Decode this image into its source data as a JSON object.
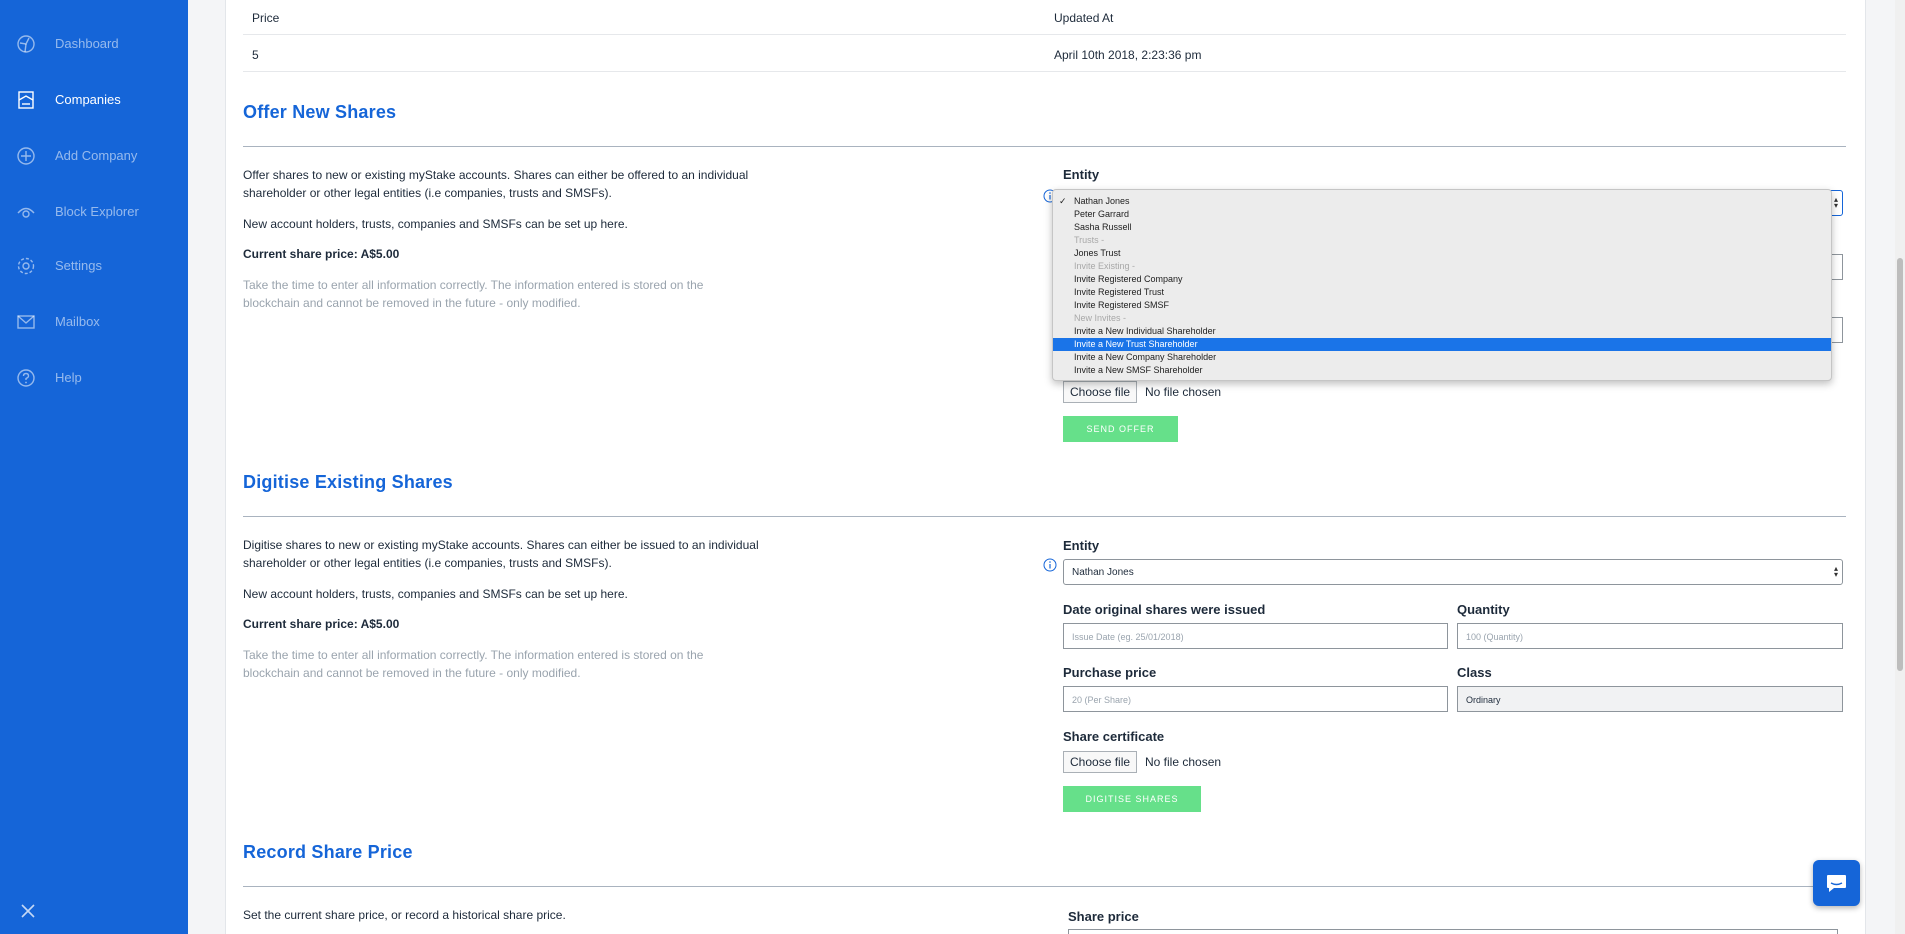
{
  "sidebar": {
    "items": [
      {
        "label": "Dashboard",
        "icon": "dashboard-icon"
      },
      {
        "label": "Companies",
        "icon": "companies-icon"
      },
      {
        "label": "Add Company",
        "icon": "add-circle-icon"
      },
      {
        "label": "Block Explorer",
        "icon": "eye-icon"
      },
      {
        "label": "Settings",
        "icon": "gear-icon"
      },
      {
        "label": "Mailbox",
        "icon": "mail-icon"
      },
      {
        "label": "Help",
        "icon": "help-icon"
      }
    ],
    "active": "Companies"
  },
  "price_table": {
    "headers": [
      "Price",
      "Updated At"
    ],
    "rows": [
      [
        "5",
        "April 10th 2018, 2:23:36 pm"
      ]
    ]
  },
  "offer": {
    "title": "Offer New Shares",
    "desc1": "Offer shares to new or existing myStake accounts. Shares can either be offered to an individual shareholder or other legal entities (i.e companies, trusts and SMSFs).",
    "desc2": "New account holders, trusts, companies and SMSFs can be set up here.",
    "price": "Current share price: A$5.00",
    "note": "Take the time to enter all information correctly. The information entered is stored on the blockchain and cannot be removed in the future - only modified.",
    "entity_label": "Entity",
    "file_button": "Choose file",
    "file_status": "No file chosen",
    "submit": "SEND OFFER",
    "dropdown": [
      {
        "label": "Nathan Jones",
        "type": "option",
        "checked": true
      },
      {
        "label": "Peter Garrard",
        "type": "option"
      },
      {
        "label": "Sasha Russell",
        "type": "option"
      },
      {
        "label": "Trusts -",
        "type": "group"
      },
      {
        "label": "Jones Trust",
        "type": "option"
      },
      {
        "label": "Invite Existing -",
        "type": "group"
      },
      {
        "label": "Invite Registered Company",
        "type": "option"
      },
      {
        "label": "Invite Registered Trust",
        "type": "option"
      },
      {
        "label": "Invite Registered SMSF",
        "type": "option"
      },
      {
        "label": "New Invites -",
        "type": "group"
      },
      {
        "label": "Invite a New Individual Shareholder",
        "type": "option"
      },
      {
        "label": "Invite a New Trust Shareholder",
        "type": "option",
        "highlighted": true
      },
      {
        "label": "Invite a New Company Shareholder",
        "type": "option"
      },
      {
        "label": "Invite a New SMSF Shareholder",
        "type": "option"
      }
    ]
  },
  "digitise": {
    "title": "Digitise Existing Shares",
    "desc1": "Digitise shares to new or existing myStake accounts. Shares can either be issued to an individual shareholder or other legal entities (i.e companies, trusts and SMSFs).",
    "desc2": "New account holders, trusts, companies and SMSFs can be set up here.",
    "price": "Current share price: A$5.00",
    "note": "Take the time to enter all information correctly. The information entered is stored on the blockchain and cannot be removed in the future - only modified.",
    "entity_label": "Entity",
    "entity_value": "Nathan Jones",
    "date_label": "Date original shares were issued",
    "date_placeholder": "Issue Date (eg. 25/01/2018)",
    "quantity_label": "Quantity",
    "quantity_placeholder": "100 (Quantity)",
    "purchase_label": "Purchase price",
    "purchase_placeholder": "20 (Per Share)",
    "class_label": "Class",
    "class_value": "Ordinary",
    "cert_label": "Share certificate",
    "file_button": "Choose file",
    "file_status": "No file chosen",
    "submit": "DIGITISE SHARES"
  },
  "record": {
    "title": "Record Share Price",
    "desc": "Set the current share price, or record a historical share price.",
    "share_price_label": "Share price"
  },
  "colors": {
    "brand": "#1565d8",
    "success": "#66e08a",
    "highlight": "#1a74e8"
  }
}
